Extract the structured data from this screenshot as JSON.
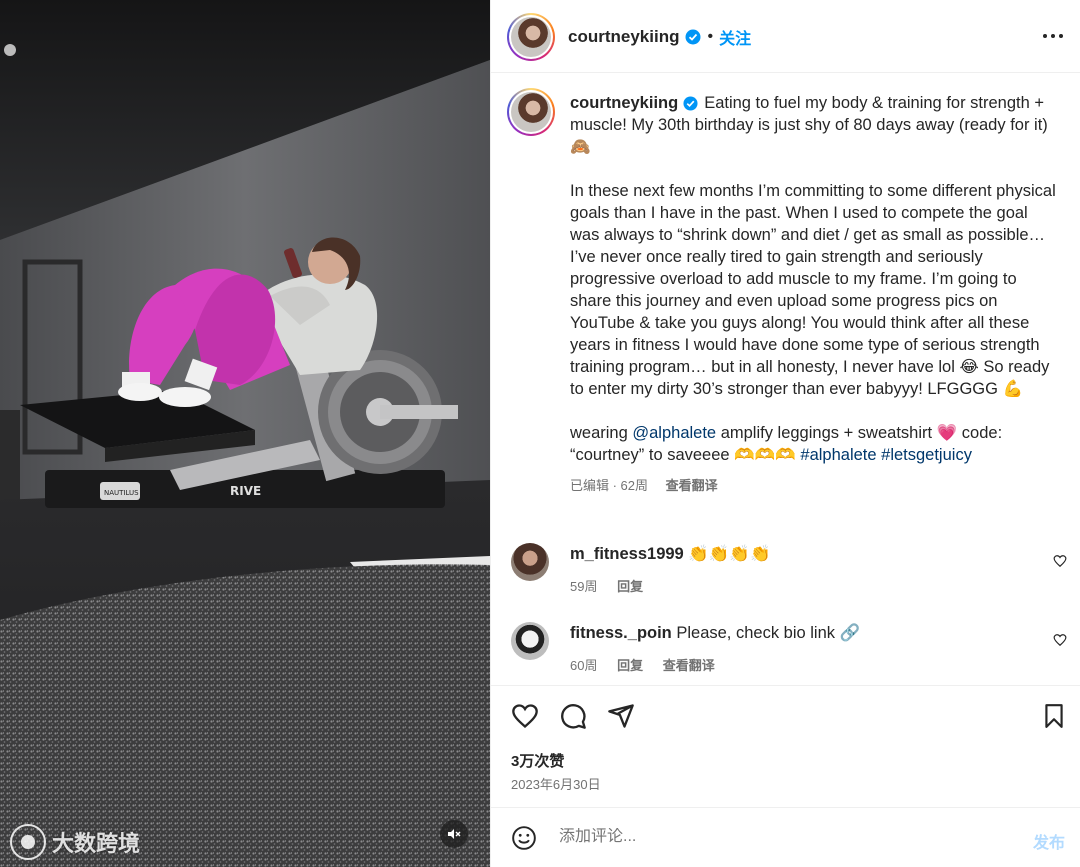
{
  "post": {
    "author": "courtneykiing",
    "follow_label": "关注",
    "separator": "•",
    "more_icon": "more-horizontal-icon",
    "caption_paragraphs": [
      "Eating to fuel my body & training for strength + muscle! My 30th birthday is just shy of 80 days away (ready for it) 🙈",
      "In these next few months I’m committing to some different physical goals than I have in the past. When I used to compete the goal was always to “shrink down” and diet / get as small as possible… I’ve never once really tired to gain strength and seriously progressive overload to add muscle to my frame. I’m going to share this journey and even upload some progress pics on YouTube & take you guys along! You would think after all these years in fitness I would have done some type of serious strength training program… but in all honesty, I never have lol 😂 So ready to enter my dirty 30’s stronger than ever babyyy! LFGGGG 💪"
    ],
    "caption_wearing_prefix": "wearing ",
    "caption_mention": "@alphalete",
    "caption_wearing_suffix": " amplify leggings + sweatshirt 💗 code: “courtney” to saveeee 🫶🫶🫶 ",
    "caption_tag1": "#alphalete",
    "caption_tag2": "#letsgetjuicy",
    "caption_meta": "已编辑 · 62周",
    "caption_translate": "查看翻译"
  },
  "comments": [
    {
      "user": "m_fitness1999",
      "text": " 👏👏👏👏",
      "age": "59周",
      "reply": "回复",
      "translate": ""
    },
    {
      "user": "fitness._poin",
      "text": " Please, check bio link 🔗",
      "age": "60周",
      "reply": "回复",
      "translate": "查看翻译"
    }
  ],
  "actions": {
    "like_icon": "heart-icon",
    "comment_icon": "comment-icon",
    "share_icon": "send-icon",
    "save_icon": "bookmark-icon"
  },
  "likes": "3万次赞",
  "date": "2023年6月30日",
  "comment_box": {
    "placeholder": "添加评论...",
    "post_label": "发布",
    "emoji_icon": "emoji-icon"
  },
  "media": {
    "watermark": "大数跨境",
    "mute_icon": "speaker-muted-icon",
    "machine_brand": "NAUTILUS",
    "machine_text": "RIVE"
  },
  "colors": {
    "link": "#0095f6",
    "tag": "#00376b",
    "verified": "#0095f6",
    "post_disabled": "#b3dbff",
    "leggings": "#d63fbf"
  }
}
